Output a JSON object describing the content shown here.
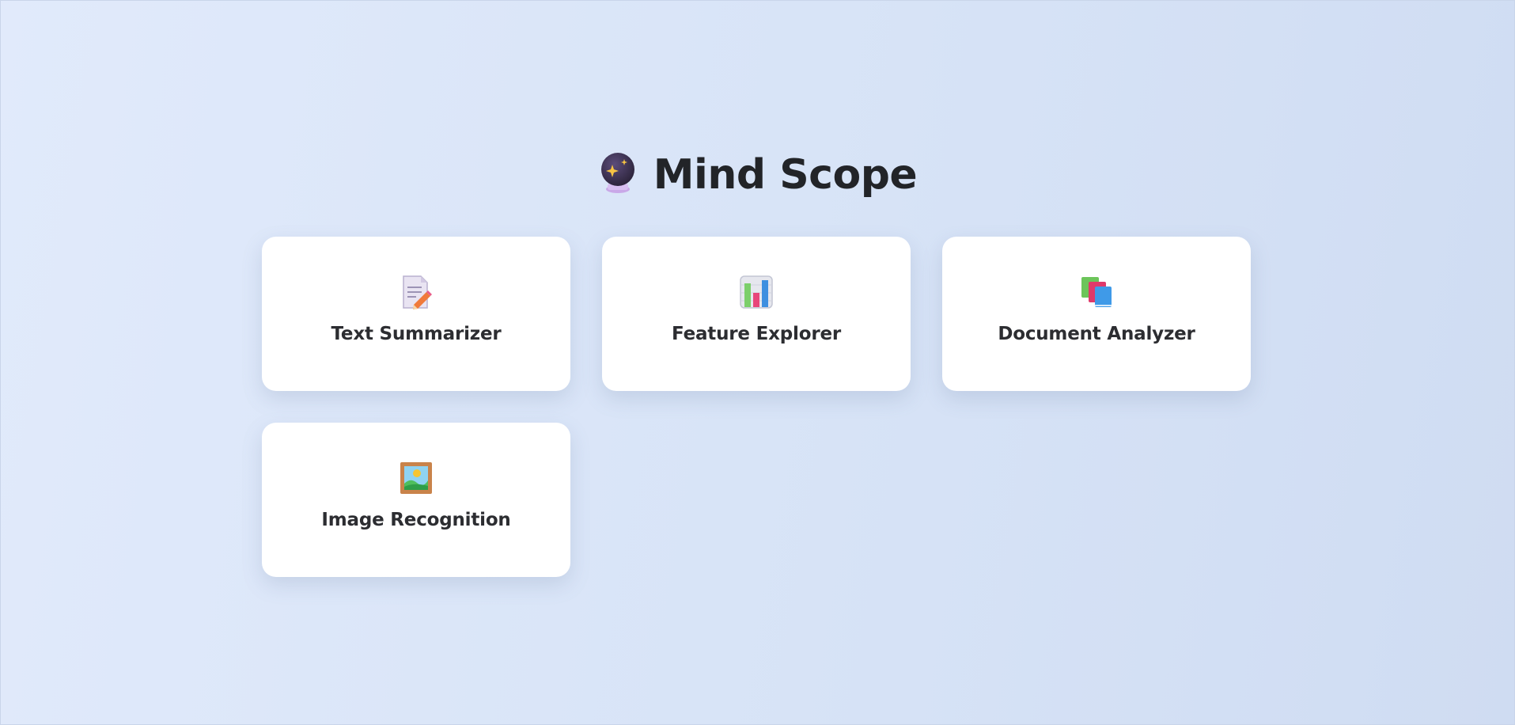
{
  "app": {
    "title": "Mind Scope",
    "logo_icon": "crystal-ball-icon"
  },
  "cards": [
    {
      "label": "Text Summarizer",
      "icon": "memo-pencil-icon"
    },
    {
      "label": "Feature Explorer",
      "icon": "bar-chart-icon"
    },
    {
      "label": "Document Analyzer",
      "icon": "books-icon"
    },
    {
      "label": "Image Recognition",
      "icon": "framed-picture-icon"
    }
  ],
  "colors": {
    "background_start": "#e1eafb",
    "background_end": "#cfdcf2",
    "card": "#ffffff",
    "title_text": "#222428",
    "card_text": "#2c2d31"
  }
}
